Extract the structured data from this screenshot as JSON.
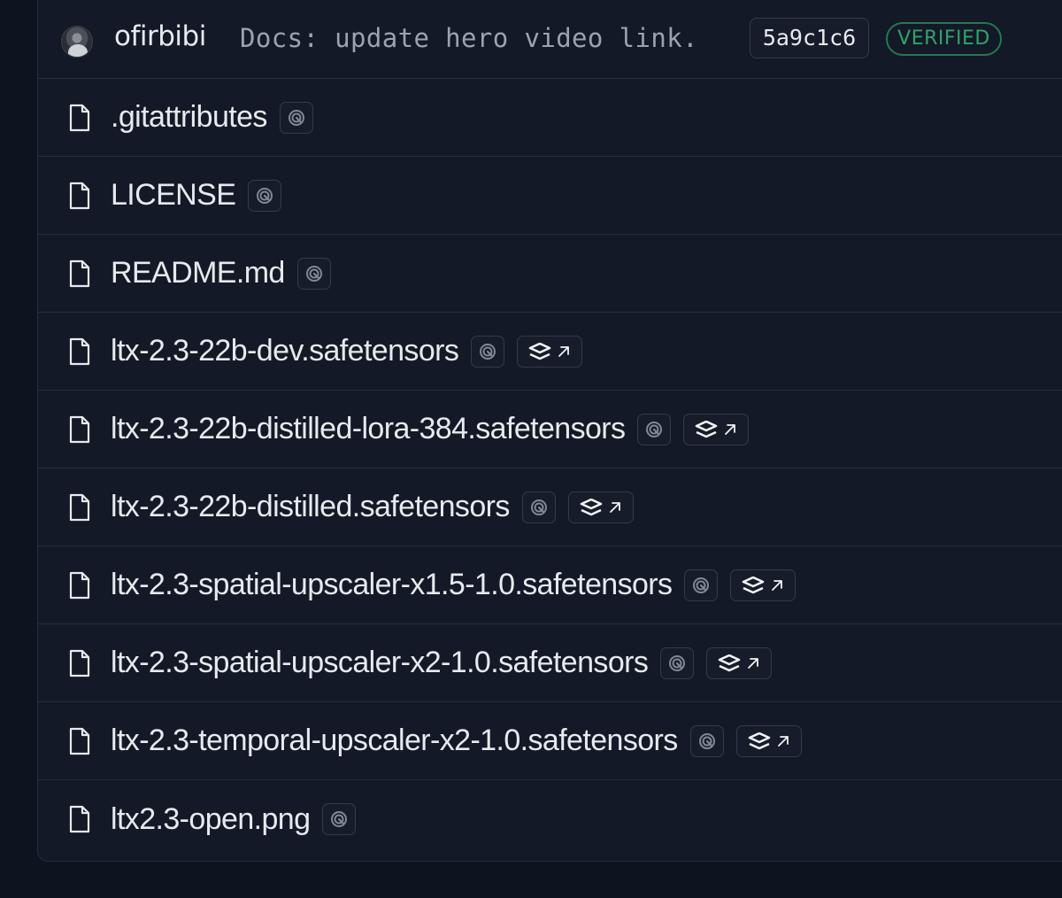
{
  "commit": {
    "author": "ofirbibi",
    "message": "Docs: update hero video link.",
    "hash": "5a9c1c6",
    "verified_label": "VERIFIED"
  },
  "colors": {
    "background": "#0e1320",
    "panel": "#131926",
    "border": "#272e3c",
    "text": "#e6e9ee",
    "muted_text": "#9aa3b2",
    "verified": "#2ea36b"
  },
  "files": [
    {
      "name": ".gitattributes",
      "scan_icon": "security-scan-icon",
      "xet": false
    },
    {
      "name": "LICENSE",
      "scan_icon": "security-scan-icon",
      "xet": false
    },
    {
      "name": "README.md",
      "scan_icon": "security-scan-icon",
      "xet": false
    },
    {
      "name": "ltx-2.3-22b-dev.safetensors",
      "scan_icon": "security-scan-icon",
      "xet": true,
      "xet_icon": "xet-storage-icon",
      "link_icon": "external-link-icon"
    },
    {
      "name": "ltx-2.3-22b-distilled-lora-384.safetensors",
      "scan_icon": "security-scan-icon",
      "xet": true,
      "xet_icon": "xet-storage-icon",
      "link_icon": "external-link-icon"
    },
    {
      "name": "ltx-2.3-22b-distilled.safetensors",
      "scan_icon": "security-scan-icon",
      "xet": true,
      "xet_icon": "xet-storage-icon",
      "link_icon": "external-link-icon"
    },
    {
      "name": "ltx-2.3-spatial-upscaler-x1.5-1.0.safetensors",
      "scan_icon": "security-scan-icon",
      "xet": true,
      "xet_icon": "xet-storage-icon",
      "link_icon": "external-link-icon"
    },
    {
      "name": "ltx-2.3-spatial-upscaler-x2-1.0.safetensors",
      "scan_icon": "security-scan-icon",
      "xet": true,
      "xet_icon": "xet-storage-icon",
      "link_icon": "external-link-icon"
    },
    {
      "name": "ltx-2.3-temporal-upscaler-x2-1.0.safetensors",
      "scan_icon": "security-scan-icon",
      "xet": true,
      "xet_icon": "xet-storage-icon",
      "link_icon": "external-link-icon"
    },
    {
      "name": "ltx2.3-open.png",
      "scan_icon": "security-scan-icon",
      "xet": false
    }
  ]
}
